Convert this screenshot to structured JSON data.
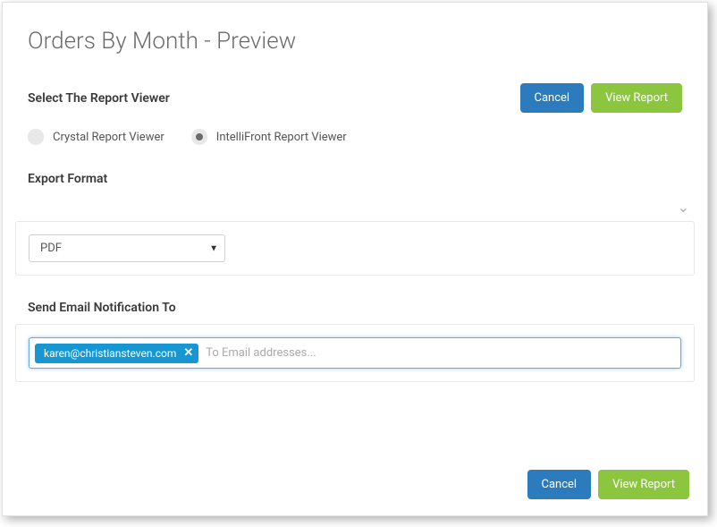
{
  "page_title": "Orders By Month - Preview",
  "viewer_section": {
    "label": "Select The Report Viewer",
    "options": [
      {
        "label": "Crystal Report Viewer",
        "selected": false
      },
      {
        "label": "IntelliFront Report Viewer",
        "selected": true
      }
    ]
  },
  "buttons": {
    "cancel": "Cancel",
    "view_report": "View Report"
  },
  "export_section": {
    "label": "Export Format",
    "selected": "PDF"
  },
  "email_section": {
    "label": "Send Email Notification To",
    "chips": [
      "karen@christiansteven.com"
    ],
    "placeholder": "To Email addresses..."
  }
}
